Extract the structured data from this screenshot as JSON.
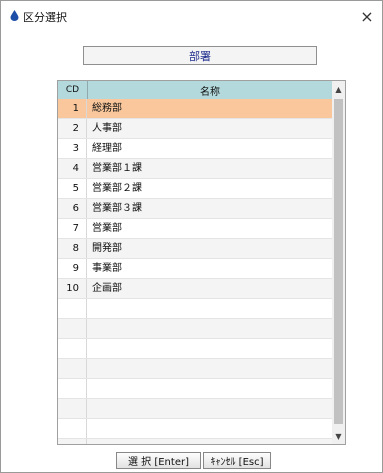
{
  "window": {
    "title": "区分選択",
    "close_label": "×"
  },
  "header": {
    "label": "部署"
  },
  "grid": {
    "columns": {
      "cd": "CD",
      "name": "名称"
    },
    "selected_index": 0,
    "rows": [
      {
        "cd": "1",
        "name": "総務部"
      },
      {
        "cd": "2",
        "name": "人事部"
      },
      {
        "cd": "3",
        "name": "経理部"
      },
      {
        "cd": "4",
        "name": "営業部１課"
      },
      {
        "cd": "5",
        "name": "営業部２課"
      },
      {
        "cd": "6",
        "name": "営業部３課"
      },
      {
        "cd": "7",
        "name": "営業部"
      },
      {
        "cd": "8",
        "name": "開発部"
      },
      {
        "cd": "9",
        "name": "事業部"
      },
      {
        "cd": "10",
        "name": "企画部"
      },
      {
        "cd": "",
        "name": ""
      },
      {
        "cd": "",
        "name": ""
      },
      {
        "cd": "",
        "name": ""
      },
      {
        "cd": "",
        "name": ""
      },
      {
        "cd": "",
        "name": ""
      },
      {
        "cd": "",
        "name": ""
      },
      {
        "cd": "",
        "name": ""
      },
      {
        "cd": "",
        "name": ""
      }
    ]
  },
  "buttons": {
    "select": "選 択 [Enter]",
    "cancel": "ｷｬﾝｾﾙ [Esc]"
  },
  "colors": {
    "header_bg": "#b3d9dd",
    "selected_bg": "#f9c79b",
    "header_text": "#1e2c8c"
  },
  "icons": {
    "app": "droplet-icon",
    "close": "close-icon",
    "up": "chevron-up-icon",
    "down": "chevron-down-icon"
  }
}
